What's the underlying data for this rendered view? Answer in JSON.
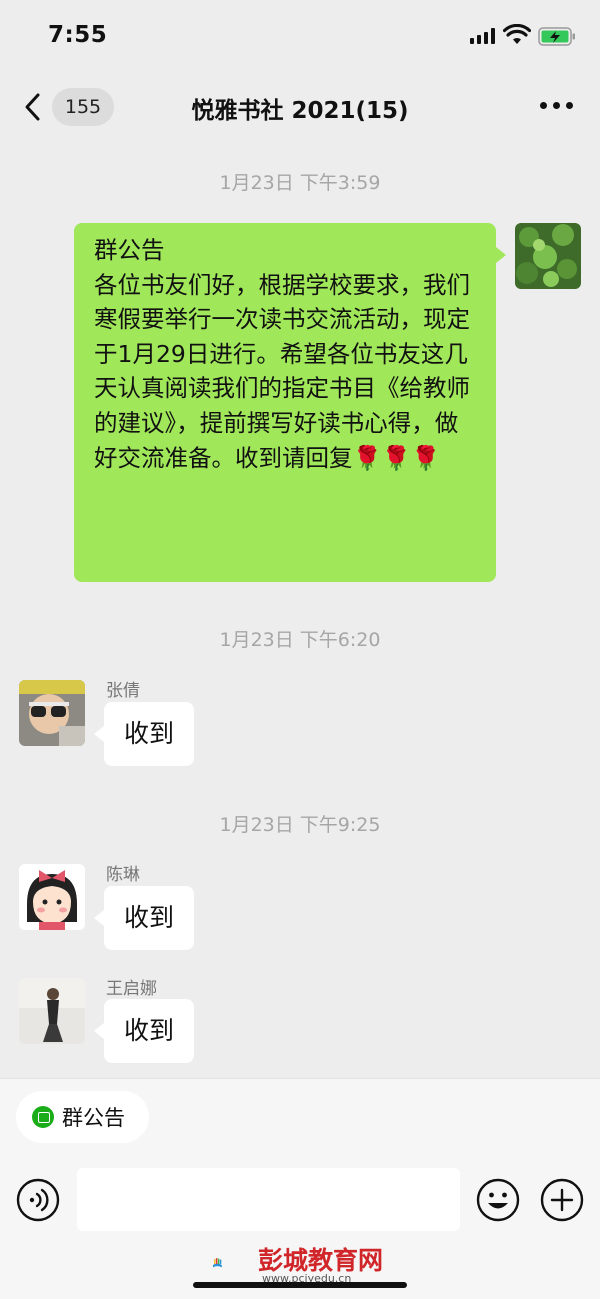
{
  "status_bar": {
    "time": "7:55"
  },
  "nav": {
    "unread_count": "155",
    "title": "悦雅书社 2021(15)"
  },
  "timestamps": [
    "1月23日 下午3:59",
    "1月23日 下午6:20",
    "1月23日 下午9:25"
  ],
  "announcement": {
    "heading": "群公告",
    "body": "各位书友们好，根据学校要求，我们寒假要举行一次读书交流活动，现定于1月29日进行。希望各位书友这几天认真阅读我们的指定书目《给教师的建议》，提前撰写好读书心得，做好交流准备。收到请回复🌹🌹🌹"
  },
  "messages": [
    {
      "sender": "张倩",
      "text": "收到"
    },
    {
      "sender": "陈琳",
      "text": "收到"
    },
    {
      "sender": "王启娜",
      "text": "收到"
    }
  ],
  "bottom": {
    "notice_chip_label": "群公告",
    "input_value": ""
  },
  "watermark": {
    "name": "彭城教育网",
    "url": "www.pcjyedu.cn"
  },
  "colors": {
    "own_bubble": "#a0e75a",
    "background": "#ededed",
    "wechat_green": "#1aad19"
  }
}
